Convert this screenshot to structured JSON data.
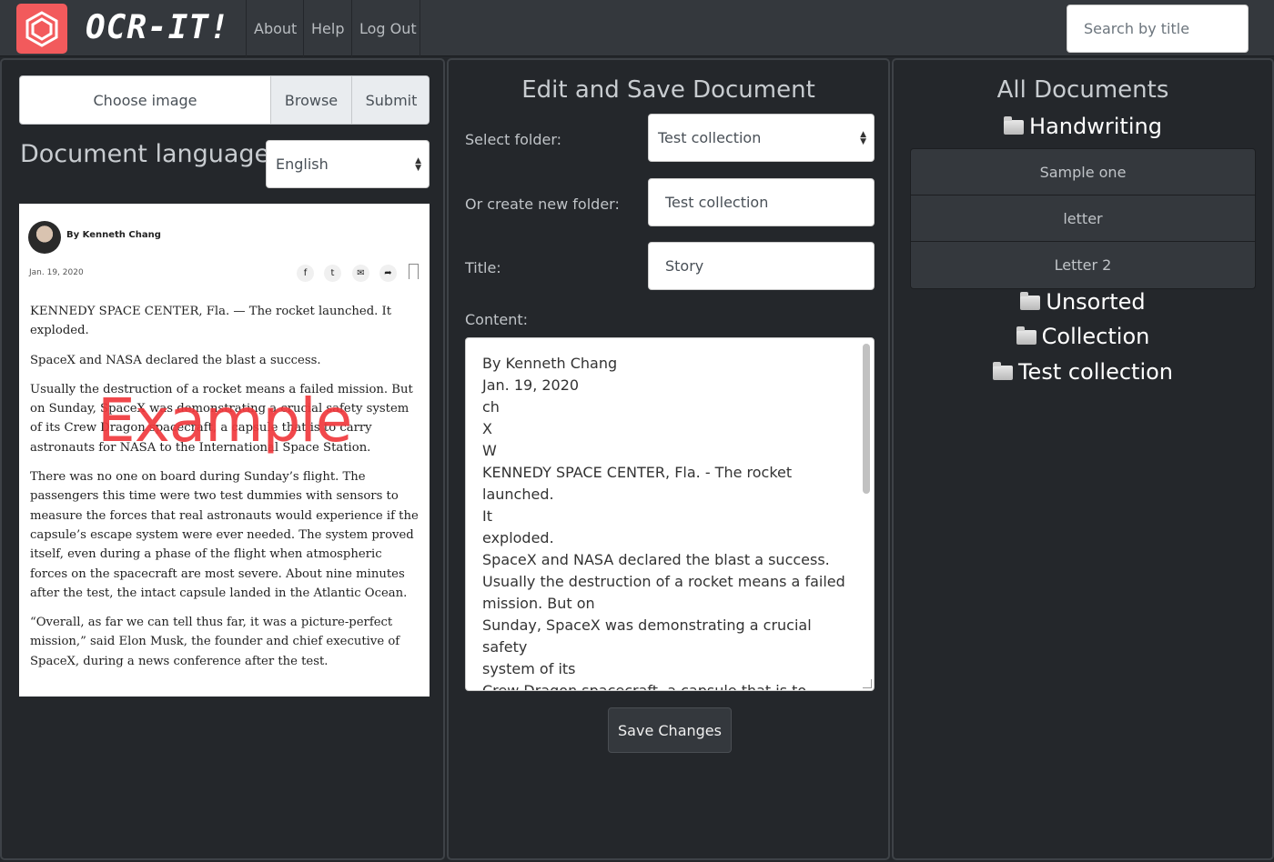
{
  "navbar": {
    "brand": "OCR-IT!",
    "links": [
      "About",
      "Help",
      "Log Out"
    ],
    "search_placeholder": "Search by title"
  },
  "upload": {
    "choose_label": "Choose image",
    "browse_label": "Browse",
    "submit_label": "Submit",
    "language_label": "Document language:",
    "language_value": "English"
  },
  "article": {
    "byline": "By Kenneth Chang",
    "date": "Jan. 19, 2020",
    "share_icons": [
      "facebook-icon",
      "twitter-icon",
      "email-icon",
      "share-icon",
      "bookmark-icon"
    ],
    "paragraphs": [
      "KENNEDY SPACE CENTER, Fla. — The rocket launched. It exploded.",
      "SpaceX and NASA declared the blast a success.",
      "Usually the destruction of a rocket means a failed mission. But on Sunday, SpaceX was demonstrating a crucial safety system of its Crew Dragon spacecraft, a capsule that is to carry astronauts for NASA to the International Space Station.",
      "There was no one on board during Sunday’s flight. The passengers this time were two test dummies with sensors to measure the forces that real astronauts would experience if the capsule’s escape system were ever needed. The system proved itself, even during a phase of the flight when atmospheric forces on the spacecraft are most severe. About nine minutes after the test, the intact capsule landed in the Atlantic Ocean.",
      "“Overall, as far we can tell thus far, it was a picture-perfect mission,” said Elon Musk, the founder and chief executive of SpaceX, during a news conference after the test."
    ],
    "watermark": "Example"
  },
  "editor": {
    "title": "Edit and Save Document",
    "select_folder_label": "Select folder:",
    "select_folder_value": "Test collection",
    "new_folder_label": "Or create new folder:",
    "new_folder_value": "Test collection",
    "title_label": "Title:",
    "title_value": "Story",
    "content_label": "Content:",
    "content_value": "By Kenneth Chang\nJan. 19, 2020\nch\nX\nW\nKENNEDY SPACE CENTER, Fla. - The rocket launched.\nIt\nexploded.\nSpaceX and NASA declared the blast a success.\nUsually the destruction of a rocket means a failed\nmission. But on\nSunday, SpaceX was demonstrating a crucial safety\nsystem of its\nCrew Dragon spacecraft, a capsule that is to carry\nastronauts for\nNASA to the International Space Station.",
    "save_label": "Save Changes"
  },
  "documents": {
    "title": "All Documents",
    "folders": [
      {
        "name": "Handwriting",
        "items": [
          "Sample one",
          "letter",
          "Letter 2"
        ]
      },
      {
        "name": "Unsorted"
      },
      {
        "name": "Collection"
      },
      {
        "name": "Test collection"
      }
    ]
  },
  "colors": {
    "accent": "#f25a5c",
    "background": "#24272b",
    "navbar": "#34383d"
  }
}
